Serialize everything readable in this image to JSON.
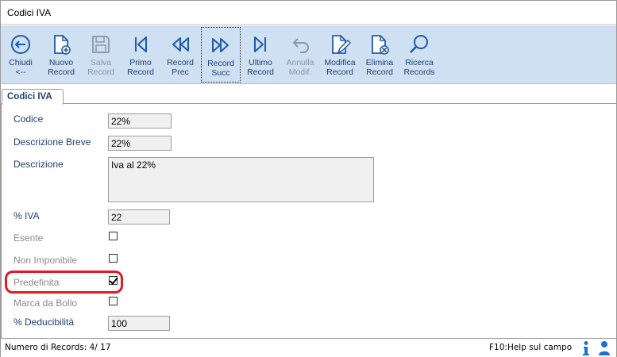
{
  "window": {
    "title": "Codici IVA"
  },
  "toolbar": {
    "chiudi": "Chiudi\n<--",
    "nuovo": "Nuovo\nRecord",
    "salva": "Salva\nRecord",
    "primo": "Primo\nRecord",
    "prec": "Record\nPrec",
    "succ": "Record\nSucc",
    "ultimo": "Ultimo\nRecord",
    "annulla": "Annulla\nModif.",
    "modifica": "Modifica\nRecord",
    "elimina": "Elimina\nRecord",
    "ricerca": "Ricerca\nRecords"
  },
  "tab": {
    "label": "Codici IVA"
  },
  "form": {
    "codice_label": "Codice",
    "codice_value": "22%",
    "descr_breve_label": "Descrizione Breve",
    "descr_breve_value": "22%",
    "descrizione_label": "Descrizione",
    "descrizione_value": "Iva al 22%",
    "iva_label": "% IVA",
    "iva_value": "22",
    "esente_label": "Esente",
    "esente_checked": false,
    "non_imponibile_label": "Non Imponibile",
    "non_imponibile_checked": false,
    "predefinita_label": "Predefinita",
    "predefinita_checked": true,
    "marca_label": "Marca da Bollo",
    "marca_checked": false,
    "deducibilita_label": "% Deducibilità",
    "deducibilita_value": "100"
  },
  "status": {
    "records": "Numero di Records: 4/ 17",
    "help": "F10:Help sul campo"
  },
  "colors": {
    "toolbar_bg": "#cfe0f3",
    "label": "#1f3f73",
    "highlight": "#e01b24"
  }
}
